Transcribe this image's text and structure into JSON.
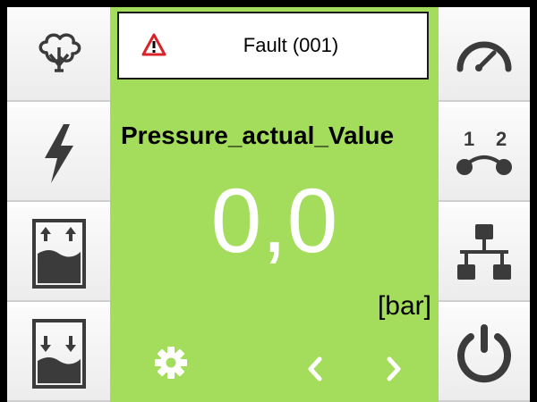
{
  "fault": {
    "icon": "warning-triangle-icon",
    "label": "Fault (001)"
  },
  "parameter": {
    "name": "Pressure_actual_Value",
    "value": "0,0",
    "unit": "[bar]"
  },
  "left_menu": [
    {
      "icon": "cloud-filter-icon"
    },
    {
      "icon": "lightning-bolt-icon"
    },
    {
      "icon": "tank-fill-icon"
    },
    {
      "icon": "tank-drain-icon"
    }
  ],
  "right_menu": [
    {
      "icon": "gauge-icon"
    },
    {
      "icon": "pump-sequence-icon",
      "text": [
        "1",
        "2"
      ]
    },
    {
      "icon": "network-icon"
    },
    {
      "icon": "power-icon"
    }
  ],
  "bottom": {
    "settings_icon": "gear-icon",
    "prev_icon": "chevron-left-icon",
    "next_icon": "chevron-right-icon"
  },
  "colors": {
    "panel_green": "#a3dd5b",
    "icon_dark": "#3b3b3b",
    "warning_red": "#d8232a",
    "value_white": "#ffffff"
  }
}
